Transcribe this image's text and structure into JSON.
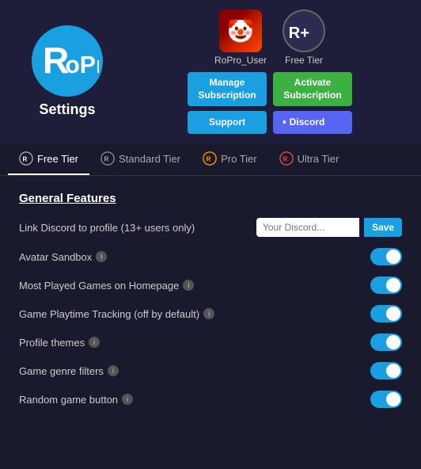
{
  "logo": {
    "alt": "RoPro Logo",
    "text": "RoPro"
  },
  "settings_label": "Settings",
  "user": {
    "name": "RoPro_User",
    "tier": "Free Tier"
  },
  "buttons": {
    "manage_subscription": "Manage\nSubscription",
    "activate_subscription": "Activate\nSubscription",
    "support": "Support",
    "discord": "Discord",
    "save": "Save"
  },
  "tabs": [
    {
      "label": "Free Tier",
      "active": true
    },
    {
      "label": "Standard Tier",
      "active": false
    },
    {
      "label": "Pro Tier",
      "active": false
    },
    {
      "label": "Ultra Tier",
      "active": false
    }
  ],
  "general_features": {
    "title": "General Features",
    "features": [
      {
        "label": "Link Discord to profile (13+ users only)",
        "type": "discord-input",
        "placeholder": "Your Discord..."
      },
      {
        "label": "Avatar Sandbox",
        "type": "toggle",
        "has_info": true,
        "enabled": true
      },
      {
        "label": "Most Played Games on Homepage",
        "type": "toggle",
        "has_info": true,
        "enabled": true
      },
      {
        "label": "Game Playtime Tracking (off by default)",
        "type": "toggle",
        "has_info": true,
        "enabled": true
      },
      {
        "label": "Profile themes",
        "type": "toggle",
        "has_info": true,
        "enabled": true
      },
      {
        "label": "Game genre filters",
        "type": "toggle",
        "has_info": true,
        "enabled": true
      },
      {
        "label": "Random game button",
        "type": "toggle",
        "has_info": true,
        "enabled": true
      }
    ]
  }
}
